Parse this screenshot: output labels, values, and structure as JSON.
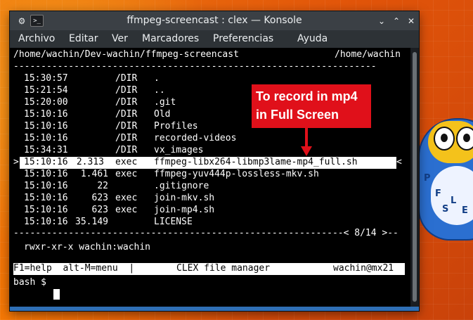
{
  "window": {
    "title": "ffmpeg-screencast : clex — Konsole",
    "controls": {
      "minimize": "⌄",
      "maximize": "⌃",
      "close": "✕"
    }
  },
  "menu": [
    "Archivo",
    "Editar",
    "Ver",
    "Marcadores",
    "Preferencias",
    "Ayuda"
  ],
  "terminal": {
    "path_left": "/home/wachin/Dev-wachin/ffmpeg-screencast",
    "path_right": "/home/wachin",
    "separator_top": "------------------------------------------------------------------",
    "files": [
      {
        "time": "15:30:57",
        "size": "",
        "type": "/DIR",
        "name": "."
      },
      {
        "time": "15:21:54",
        "size": "",
        "type": "/DIR",
        "name": ".."
      },
      {
        "time": "15:20:00",
        "size": "",
        "type": "/DIR",
        "name": ".git"
      },
      {
        "time": "15:10:16",
        "size": "",
        "type": "/DIR",
        "name": "Old"
      },
      {
        "time": "15:10:16",
        "size": "",
        "type": "/DIR",
        "name": "Profiles"
      },
      {
        "time": "15:10:16",
        "size": "",
        "type": "/DIR",
        "name": "recorded-videos"
      },
      {
        "time": "15:34:31",
        "size": "",
        "type": "/DIR",
        "name": "vx_images"
      },
      {
        "time": "15:10:16",
        "size": "2.313",
        "type": "exec",
        "name": "ffmpeg-libx264-libmp3lame-mp4_full.sh",
        "selected": true
      },
      {
        "time": "15:10:16",
        "size": "1.461",
        "type": "exec",
        "name": "ffmpeg-yuv444p-lossless-mkv.sh"
      },
      {
        "time": "15:10:16",
        "size": "22",
        "type": "",
        "name": ".gitignore"
      },
      {
        "time": "15:10:16",
        "size": "623",
        "type": "exec",
        "name": "join-mkv.sh"
      },
      {
        "time": "15:10:16",
        "size": "623",
        "type": "exec",
        "name": "join-mp4.sh"
      },
      {
        "time": "15:10:16",
        "size": "35.149",
        "type": "",
        "name": "LICENSE"
      }
    ],
    "separator_bottom": "------------------------------------------------------------< 8/14 >--",
    "permissions": "rwxr-xr-x wachin:wachin",
    "status": {
      "help": "F1=help  alt-M=menu  |",
      "center": "CLEX file manager",
      "user": "wachin@mx21"
    },
    "prompt": "bash $",
    "selection_marker_left": ">",
    "selection_marker_right": "<"
  },
  "annotation": {
    "line1": "To record in mp4",
    "line2": "in Full Screen"
  },
  "mascot_letters": [
    "P",
    "F",
    "S",
    "L",
    "E"
  ],
  "colors": {
    "accent": "#e0101a",
    "titlebar": "#3b4045",
    "terminal_bg": "#000000"
  }
}
